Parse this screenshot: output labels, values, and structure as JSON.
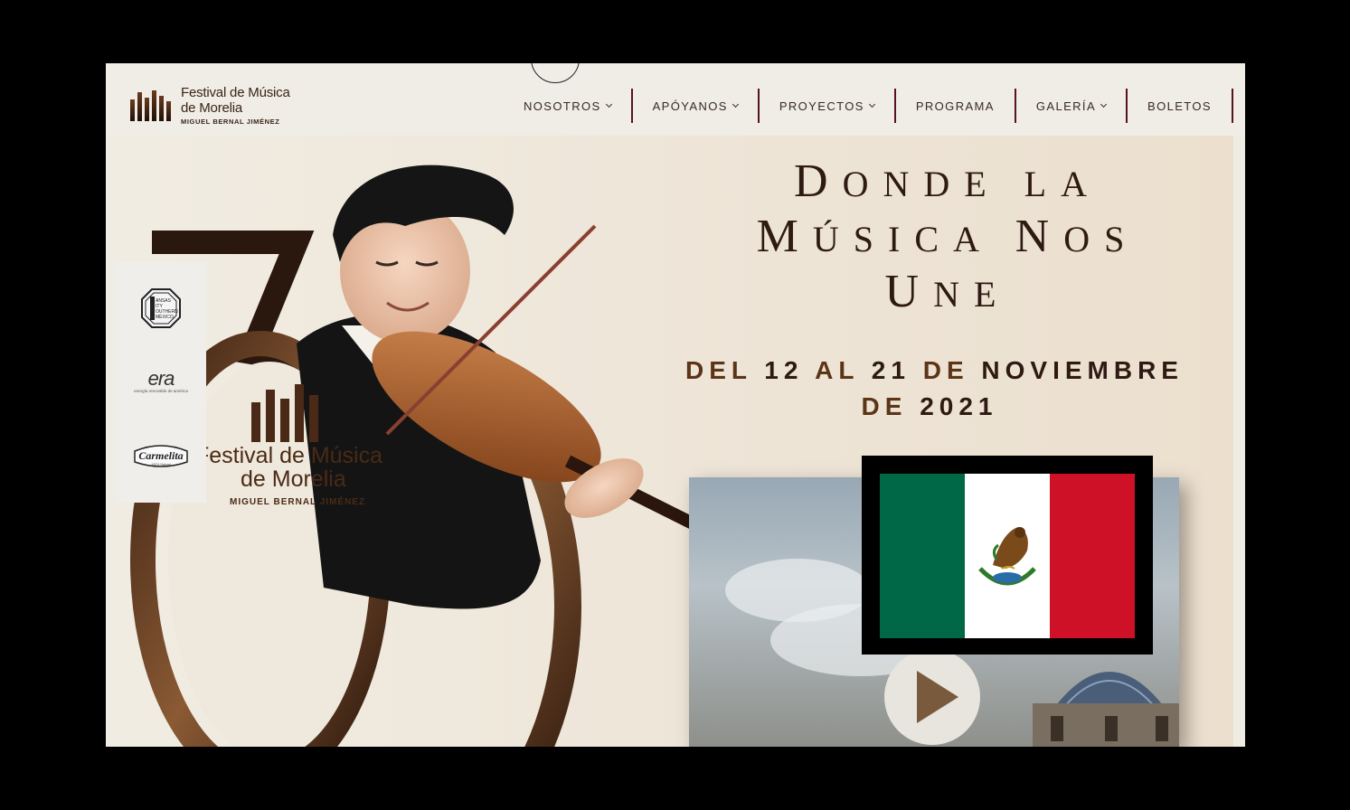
{
  "logo": {
    "line1": "Festival de Música",
    "line2": "de Morelia",
    "line3": "MIGUEL BERNAL JIMÉNEZ"
  },
  "nav": {
    "items": [
      {
        "label": "NOSOTROS",
        "dropdown": true
      },
      {
        "label": "APÓYANOS",
        "dropdown": true
      },
      {
        "label": "PROYECTOS",
        "dropdown": true
      },
      {
        "label": "PROGRAMA",
        "dropdown": false
      },
      {
        "label": "GALERÍA",
        "dropdown": true
      },
      {
        "label": "BOLETOS",
        "dropdown": false
      }
    ]
  },
  "hero": {
    "title_line1": [
      "D",
      "onde la"
    ],
    "title_line2": [
      "M",
      "úsica ",
      "N",
      "os"
    ],
    "title_line3": [
      "U",
      "ne"
    ],
    "date_line1": [
      "DEL ",
      "12",
      " AL ",
      "21",
      " DE ",
      "NOVIEMBRE"
    ],
    "date_line2": [
      "DE ",
      "2021"
    ],
    "art_logo_line1": "Festival de Música",
    "art_logo_line2": "de Morelia",
    "art_logo_line3": "MIGUEL BERNAL JIMÉNEZ"
  },
  "sponsors": {
    "items": [
      {
        "name": "Kansas City Southern de México",
        "lines": [
          "ANSAS",
          "ITY",
          "OUTHERN",
          "MÉXICO"
        ]
      },
      {
        "name": "era",
        "word": "era",
        "sub": "energía renovable de américa"
      },
      {
        "name": "Carmelita",
        "word": "Carmelita",
        "sub": "100% Natural"
      }
    ]
  },
  "colors": {
    "nav_divider": "#5a1220",
    "title_text": "#2e1a12",
    "date_text": "#5c3416",
    "flag_green": "#006847",
    "flag_red": "#ce1126"
  }
}
